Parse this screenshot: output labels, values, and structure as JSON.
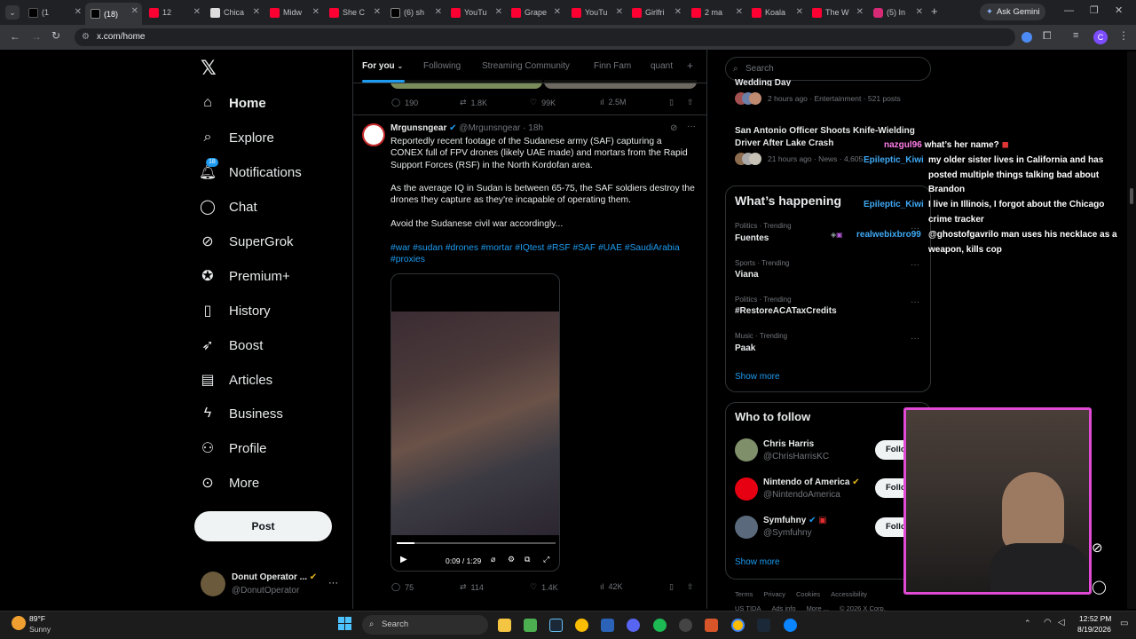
{
  "browser": {
    "tabs": [
      {
        "label": "(1"
      },
      {
        "label": "(18) "
      },
      {
        "label": "12"
      },
      {
        "label": "Chica"
      },
      {
        "label": "Midw"
      },
      {
        "label": "She C"
      },
      {
        "label": "(6) sh"
      },
      {
        "label": "YouTu"
      },
      {
        "label": "Grape"
      },
      {
        "label": "YouTu"
      },
      {
        "label": "Girlfri"
      },
      {
        "label": "2 ma"
      },
      {
        "label": "Koala"
      },
      {
        "label": "The W"
      },
      {
        "label": "(5) In"
      }
    ],
    "new_tab": "+",
    "gemini": "Ask Gemini",
    "url": "x.com/home"
  },
  "nav": {
    "items": [
      {
        "label": "Home"
      },
      {
        "label": "Explore"
      },
      {
        "label": "Notifications",
        "badge": "18"
      },
      {
        "label": "Chat"
      },
      {
        "label": "SuperGrok"
      },
      {
        "label": "Premium+"
      },
      {
        "label": "History"
      },
      {
        "label": "Boost"
      },
      {
        "label": "Articles"
      },
      {
        "label": "Business"
      },
      {
        "label": "Profile"
      },
      {
        "label": "More"
      }
    ],
    "post": "Post",
    "account_name": "Donut Operator ...",
    "account_handle": "@DonutOperator"
  },
  "feed": {
    "tabs": [
      "For you",
      "Following",
      "Streaming Community",
      "Finn Fam",
      "quant"
    ],
    "prev_actions": {
      "replies": "190",
      "reposts": "1.8K",
      "likes": "99K",
      "views": "2.5M"
    },
    "post": {
      "author": "Mrgunsngear",
      "handle": "@Mrgunsngear",
      "time": "· 18h",
      "p1": "Reportedly recent footage of the Sudanese army (SAF) capturing a CONEX full of FPV drones (likely UAE made) and mortars from the Rapid Support Forces (RSF) in the North Kordofan area.",
      "p2": "As the average IQ in Sudan is between 65-75, the SAF soldiers destroy the drones they capture as they're incapable of operating them.",
      "p3": "Avoid the Sudanese civil war accordingly...",
      "hashtags": "#war #sudan #drones #mortar #IQtest #RSF #SAF #UAE #SaudiArabia #proxies",
      "video_time": "0:09 / 1:29",
      "video_progress": 0.11,
      "replies": "75",
      "reposts": "114",
      "likes": "1.4K",
      "views": "42K"
    }
  },
  "right": {
    "search_placeholder": "Search",
    "top_trend_tail": "Wedding Day",
    "top_trend_meta": "2 hours ago · Entertainment · 521 posts",
    "story2_title": "San Antonio Officer Shoots Knife-Wielding Driver After Lake Crash",
    "story2_meta": "21 hours ago · News · 4,605",
    "whats_happening": "What’s happening",
    "trends": [
      {
        "cat": "Politics · Trending",
        "name": "Fuentes"
      },
      {
        "cat": "Sports · Trending",
        "name": "Viana"
      },
      {
        "cat": "Politics · Trending",
        "name": "#RestoreACATaxCredits"
      },
      {
        "cat": "Music · Trending",
        "name": "Paak"
      }
    ],
    "show_more": "Show more",
    "who_to_follow": "Who to follow",
    "follow": [
      {
        "name": "Chris Harris",
        "handle": "@ChrisHarrisKC",
        "btn": "Follo"
      },
      {
        "name": "Nintendo of America",
        "handle": "@NintendoAmerica",
        "btn": "Follo"
      },
      {
        "name": "Symfuhny",
        "handle": "@Symfuhny",
        "btn": "Follo"
      }
    ],
    "show_more2": "Show more",
    "footer1": [
      "Terms",
      "Privacy",
      "Cookies",
      "Accessibility"
    ],
    "footer2": [
      "US TIDA",
      "Ads info",
      "More ...",
      "© 2026 X Corp."
    ]
  },
  "chat": [
    {
      "user": "nazgul96",
      "msg": "what’s her name?"
    },
    {
      "user": "Epileptic_Kiwi",
      "msg": "my older sister lives in California and has posted multiple things talking bad about Brandon"
    },
    {
      "user": "Epileptic_Kiwi",
      "msg": "I live in Illinois, I forgot about the Chicago crime tracker"
    },
    {
      "user": "realwebixbro99",
      "msg": "@ghostofgavrilo man uses his necklace as a weapon, kills cop"
    }
  ],
  "taskbar": {
    "temp": "89°F",
    "weather": "Sunny",
    "search": "Search",
    "time": "12:52 PM",
    "date": "8/19/2026"
  },
  "colors": {
    "accent": "#1d9bf0",
    "bg": "#000000",
    "border": "#2f3336"
  }
}
